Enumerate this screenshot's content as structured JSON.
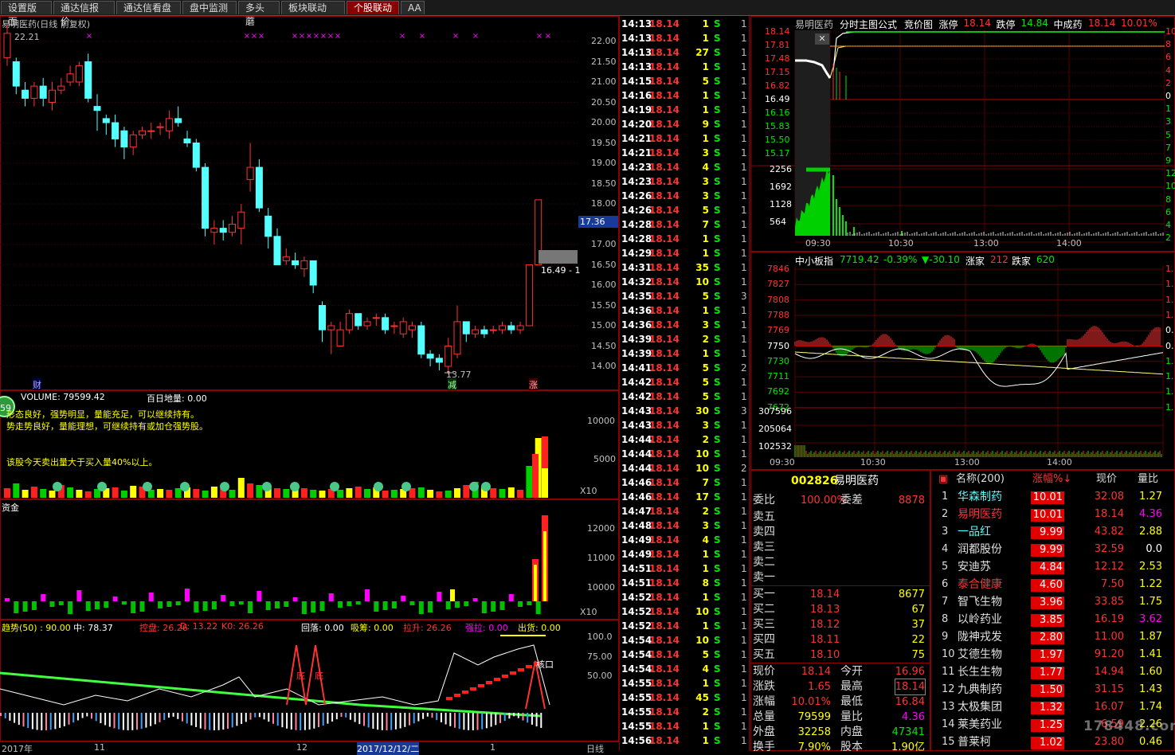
{
  "tabs": [
    "设置版面",
    "通达信报价",
    "通达信看盘",
    "盘中监测",
    "多头蘑",
    "板块联动",
    "个股联动",
    "AA"
  ],
  "active_tab": 6,
  "kline": {
    "title": "易明医药(日线 前复权)",
    "high_label": "22.21",
    "low_label": "13.77",
    "price_ticks": [
      "22.00",
      "21.50",
      "21.00",
      "20.50",
      "20.00",
      "19.50",
      "19.00",
      "18.50",
      "18.00",
      "17.50",
      "17.00",
      "16.50",
      "16.00",
      "15.50",
      "15.00",
      "14.50",
      "14.00"
    ],
    "current_tag": "17.36",
    "box_label": "16.49 - 1",
    "markers": [
      "财",
      "减",
      "涨"
    ]
  },
  "volume": {
    "title": "VOLUME: 79599.42",
    "title2": "百日地量: 0.00",
    "note1": "形态良好，强势明显，量能充足，可以继续持有。",
    "note2": "势走势良好，量能理想，可继续持有或加仓强势股。",
    "note3": "该股今天卖出量大于买入量40%以上。",
    "ticks": [
      "10000",
      "5000",
      "X10"
    ],
    "badge": "59"
  },
  "funds": {
    "title": "资金",
    "ticks": [
      "12000",
      "11000",
      "10000",
      "X10"
    ]
  },
  "trend": {
    "items": [
      {
        "t": "趋势(50) : 90.00",
        "c": "#ffff00"
      },
      {
        "t": "中: 78.37",
        "c": "#ffffff"
      },
      {
        "t": "控盘: 26.26",
        "c": "#ff3232"
      },
      {
        "t": "D: 13.22",
        "c": "#ff3232"
      },
      {
        "t": "K0: 26.26",
        "c": "#ff3232"
      },
      {
        "t": "回落: 0.00",
        "c": "#ffffff"
      },
      {
        "t": "吸筹: 0.00",
        "c": "#ffff00"
      },
      {
        "t": "拉升: 26.26",
        "c": "#ff3232"
      },
      {
        "t": "强拉: 0.00",
        "c": "#ff00ff"
      },
      {
        "t": "出货: 0.00",
        "c": "#ffff00"
      }
    ],
    "ticks": [
      "100.0",
      "75.00",
      "50.00"
    ],
    "marks": [
      "底",
      "底",
      "核口"
    ]
  },
  "date_axis": [
    "2017年",
    "11",
    "12",
    "2017/12/12/二",
    "1",
    "日线"
  ],
  "ticks_list": {
    "rows": [
      [
        "14:13",
        "18.14",
        "1",
        "S",
        "1"
      ],
      [
        "14:13",
        "18.14",
        "1",
        "S",
        "1"
      ],
      [
        "14:13",
        "18.14",
        "27",
        "S",
        "1"
      ],
      [
        "14:13",
        "18.14",
        "1",
        "S",
        "1"
      ],
      [
        "14:15",
        "18.14",
        "5",
        "S",
        "1"
      ],
      [
        "14:16",
        "18.14",
        "1",
        "S",
        "1"
      ],
      [
        "14:19",
        "18.14",
        "1",
        "S",
        "1"
      ],
      [
        "14:20",
        "18.14",
        "9",
        "S",
        "1"
      ],
      [
        "14:21",
        "18.14",
        "1",
        "S",
        "1"
      ],
      [
        "14:21",
        "18.14",
        "3",
        "S",
        "1"
      ],
      [
        "14:23",
        "18.14",
        "4",
        "S",
        "1"
      ],
      [
        "14:23",
        "18.14",
        "3",
        "S",
        "1"
      ],
      [
        "14:26",
        "18.14",
        "3",
        "S",
        "1"
      ],
      [
        "14:26",
        "18.14",
        "5",
        "S",
        "1"
      ],
      [
        "14:28",
        "18.14",
        "7",
        "S",
        "1"
      ],
      [
        "14:28",
        "18.14",
        "1",
        "S",
        "1"
      ],
      [
        "14:29",
        "18.14",
        "1",
        "S",
        "1"
      ],
      [
        "14:31",
        "18.14",
        "35",
        "S",
        "1"
      ],
      [
        "14:32",
        "18.14",
        "10",
        "S",
        "1"
      ],
      [
        "14:35",
        "18.14",
        "5",
        "S",
        "3"
      ],
      [
        "14:36",
        "18.14",
        "1",
        "S",
        "1"
      ],
      [
        "14:36",
        "18.14",
        "3",
        "S",
        "1"
      ],
      [
        "14:39",
        "18.14",
        "2",
        "S",
        "1"
      ],
      [
        "14:39",
        "18.14",
        "1",
        "S",
        "1"
      ],
      [
        "14:41",
        "18.14",
        "5",
        "S",
        "2"
      ],
      [
        "14:42",
        "18.14",
        "5",
        "S",
        "1"
      ],
      [
        "14:42",
        "18.14",
        "5",
        "S",
        "1"
      ],
      [
        "14:43",
        "18.14",
        "30",
        "S",
        "3"
      ],
      [
        "14:43",
        "18.14",
        "3",
        "S",
        "1"
      ],
      [
        "14:44",
        "18.14",
        "2",
        "S",
        "1"
      ],
      [
        "14:44",
        "18.14",
        "10",
        "S",
        "1"
      ],
      [
        "14:44",
        "18.14",
        "10",
        "S",
        "2"
      ],
      [
        "14:46",
        "18.14",
        "7",
        "S",
        "1"
      ],
      [
        "14:46",
        "18.14",
        "17",
        "S",
        "1"
      ],
      [
        "14:47",
        "18.14",
        "2",
        "S",
        "1"
      ],
      [
        "14:48",
        "18.14",
        "3",
        "S",
        "1"
      ],
      [
        "14:49",
        "18.14",
        "4",
        "S",
        "1"
      ],
      [
        "14:49",
        "18.14",
        "1",
        "S",
        "1"
      ],
      [
        "14:51",
        "18.14",
        "1",
        "S",
        "1"
      ],
      [
        "14:51",
        "18.14",
        "8",
        "S",
        "1"
      ],
      [
        "14:52",
        "18.14",
        "1",
        "S",
        "1"
      ],
      [
        "14:52",
        "18.14",
        "10",
        "S",
        "1"
      ],
      [
        "14:52",
        "18.14",
        "1",
        "S",
        "1"
      ],
      [
        "14:54",
        "18.14",
        "10",
        "S",
        "1"
      ],
      [
        "14:54",
        "18.14",
        "5",
        "S",
        "1"
      ],
      [
        "14:54",
        "18.14",
        "4",
        "S",
        "1"
      ],
      [
        "14:55",
        "18.14",
        "1",
        "S",
        "1"
      ],
      [
        "14:55",
        "18.14",
        "45",
        "S",
        "1"
      ],
      [
        "14:55",
        "18.14",
        "2",
        "S",
        "1"
      ],
      [
        "14:55",
        "18.14",
        "1",
        "S",
        "1"
      ],
      [
        "14:56",
        "18.14",
        "1",
        "S",
        "1"
      ]
    ]
  },
  "intraday": {
    "header": [
      {
        "t": "易明医药",
        "c": "#c0c0c0"
      },
      {
        "t": "分时主图公式",
        "c": "#ffffff"
      },
      {
        "t": "竞价图",
        "c": "#ffffff"
      },
      {
        "t": "涨停",
        "c": "#ffffff"
      },
      {
        "t": "18.14",
        "c": "#ff3232"
      },
      {
        "t": "跌停",
        "c": "#ffffff"
      },
      {
        "t": "14.84",
        "c": "#00e600"
      },
      {
        "t": "中成药",
        "c": "#ffffff"
      },
      {
        "t": "18.14",
        "c": "#ff3232"
      },
      {
        "t": "10.01%",
        "c": "#ff3232"
      }
    ],
    "price_ticks": [
      "18.14",
      "17.81",
      "17.48",
      "17.15",
      "16.82",
      "16.49",
      "16.16",
      "15.83",
      "15.50",
      "15.17"
    ],
    "vol_ticks": [
      "2256",
      "1692",
      "1128",
      "564"
    ],
    "times": [
      "09:30",
      "10:30",
      "13:00",
      "14:00"
    ],
    "right_ticks": [
      "10",
      "8",
      "6",
      "4",
      "2",
      "0",
      "1",
      "3",
      "5",
      "7",
      "9",
      "12",
      "10",
      "8",
      "6",
      "4",
      "2"
    ]
  },
  "index_chart": {
    "header": [
      {
        "t": "中小板指",
        "c": "#ffffff"
      },
      {
        "t": "7719.42",
        "c": "#00e600"
      },
      {
        "t": "-0.39%",
        "c": "#00e600"
      },
      {
        "t": "▼-30.10",
        "c": "#00e600"
      },
      {
        "t": "涨家",
        "c": "#ffffff"
      },
      {
        "t": "212",
        "c": "#ff3232"
      },
      {
        "t": "跌家",
        "c": "#ffffff"
      },
      {
        "t": "620",
        "c": "#00e600"
      }
    ],
    "price_ticks": [
      "7846",
      "7827",
      "7808",
      "7788",
      "7769",
      "7750",
      "7730",
      "7711",
      "7692",
      "7672"
    ],
    "vol_ticks": [
      "307596",
      "205064",
      "102532"
    ],
    "times": [
      "09:30",
      "10:30",
      "13:00",
      "14:00"
    ],
    "right_ticks": [
      "1.",
      "1.",
      "1.",
      "1.",
      "0.",
      "0.",
      "1.",
      "1.",
      "1.",
      "1."
    ]
  },
  "quote": {
    "code": "002826",
    "name": "易明医药",
    "weibi": "委比",
    "weibi_v": "100.00%",
    "weicha": "委差",
    "weicha_v": "8878",
    "sells": [
      "卖五",
      "卖四",
      "卖三",
      "卖二",
      "卖一"
    ],
    "buys": [
      [
        "买一",
        "18.14",
        "8677"
      ],
      [
        "买二",
        "18.13",
        "67"
      ],
      [
        "买三",
        "18.12",
        "37"
      ],
      [
        "买四",
        "18.11",
        "22"
      ],
      [
        "买五",
        "18.10",
        "75"
      ]
    ],
    "stats": [
      [
        "现价",
        "18.14",
        "今开",
        "16.96"
      ],
      [
        "涨跌",
        "1.65",
        "最高",
        "18.14"
      ],
      [
        "涨幅",
        "10.01%",
        "最低",
        "16.84"
      ],
      [
        "总量",
        "79599",
        "量比",
        "4.36"
      ],
      [
        "外盘",
        "32258",
        "内盘",
        "47341"
      ],
      [
        "换手",
        "7.90%",
        "股本",
        "1.90亿"
      ]
    ]
  },
  "ranking": {
    "headers": [
      "名称(200)",
      "涨幅%↓",
      "现价",
      "量比"
    ],
    "rows": [
      [
        "1",
        "华森制药",
        "10.01",
        "32.08",
        "1.27",
        "#54ffff"
      ],
      [
        "2",
        "易明医药",
        "10.01",
        "18.14",
        "4.36",
        "#ff3232"
      ],
      [
        "3",
        "一品红",
        "9.99",
        "43.82",
        "2.88",
        "#54ffff"
      ],
      [
        "4",
        "润都股份",
        "9.99",
        "32.59",
        "0.0",
        "#e0e0e0"
      ],
      [
        "5",
        "安迪苏",
        "4.84",
        "12.12",
        "2.53",
        "#e0e0e0"
      ],
      [
        "6",
        "泰合健康",
        "4.60",
        "7.50",
        "1.22",
        "#ff3232"
      ],
      [
        "7",
        "智飞生物",
        "3.96",
        "33.85",
        "1.75",
        "#e0e0e0"
      ],
      [
        "8",
        "以岭药业",
        "3.85",
        "16.19",
        "3.62",
        "#e0e0e0"
      ],
      [
        "9",
        "陇神戎发",
        "2.80",
        "11.00",
        "1.87",
        "#e0e0e0"
      ],
      [
        "10",
        "艾德生物",
        "1.97",
        "91.20",
        "1.41",
        "#e0e0e0"
      ],
      [
        "11",
        "长生生物",
        "1.77",
        "14.94",
        "1.60",
        "#e0e0e0"
      ],
      [
        "12",
        "九典制药",
        "1.50",
        "31.15",
        "1.43",
        "#e0e0e0"
      ],
      [
        "13",
        "太极集团",
        "1.32",
        "16.07",
        "1.74",
        "#e0e0e0"
      ],
      [
        "14",
        "莱美药业",
        "1.25",
        "6.59",
        "2.26",
        "#e0e0e0"
      ],
      [
        "15",
        "普莱柯",
        "1.02",
        "23.80",
        "0.46",
        "#e0e0e0"
      ]
    ]
  },
  "watermark": "178448.com",
  "colors": {
    "up": "#ff3232",
    "down": "#54ffff",
    "grid": "#8b0000",
    "bg": "#000000"
  }
}
